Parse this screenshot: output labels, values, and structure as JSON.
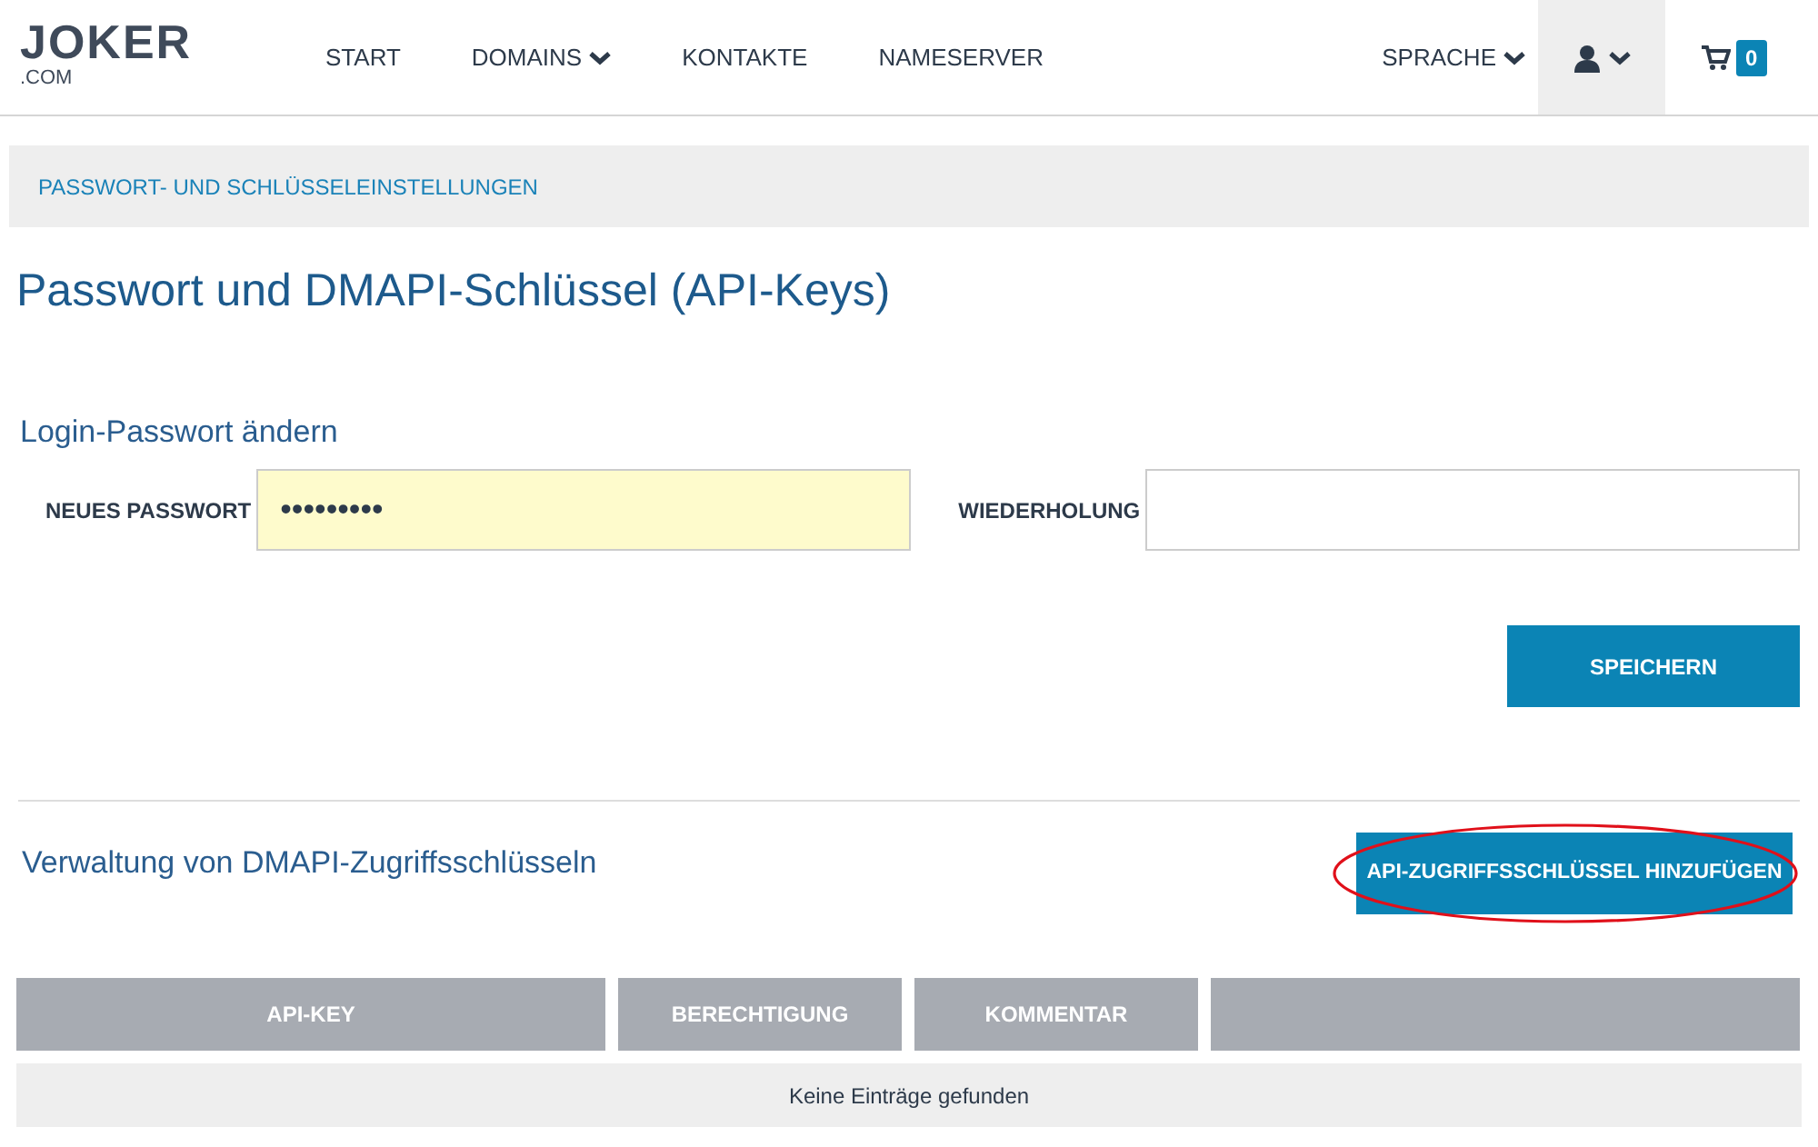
{
  "logo": {
    "name": "JOKER",
    "suffix": ".COM"
  },
  "nav": [
    {
      "label": "START",
      "dropdown": false
    },
    {
      "label": "DOMAINS",
      "dropdown": true
    },
    {
      "label": "KONTAKTE",
      "dropdown": false
    },
    {
      "label": "NAMESERVER",
      "dropdown": false
    }
  ],
  "language_menu": {
    "label": "SPRACHE",
    "dropdown": true
  },
  "user_menu": {
    "selected": true
  },
  "cart": {
    "count": "0"
  },
  "breadcrumb": "PASSWORT- UND SCHLÜSSELEINSTELLUNGEN",
  "title": "Passwort und DMAPI-Schlüssel (API-Keys)",
  "password_section": {
    "heading": "Login-Passwort ändern",
    "fields": [
      {
        "label": "NEUES PASSWORT",
        "value": "•••••••••",
        "autofilled": true
      },
      {
        "label": "WIEDERHOLUNG",
        "autofilled": false
      }
    ],
    "button": "SPEICHERN"
  },
  "api_section": {
    "heading": "Verwaltung von DMAPI-Zugriffsschlüsseln",
    "button": "API-ZUGRIFFSSCHLÜSSEL HINZUFÜGEN",
    "button_circled": true,
    "table": {
      "columns": [
        "API-KEY",
        "BERECHTIGUNG",
        "KOMMENTAR",
        ""
      ],
      "empty_message": "Keine Einträge gefunden"
    }
  }
}
